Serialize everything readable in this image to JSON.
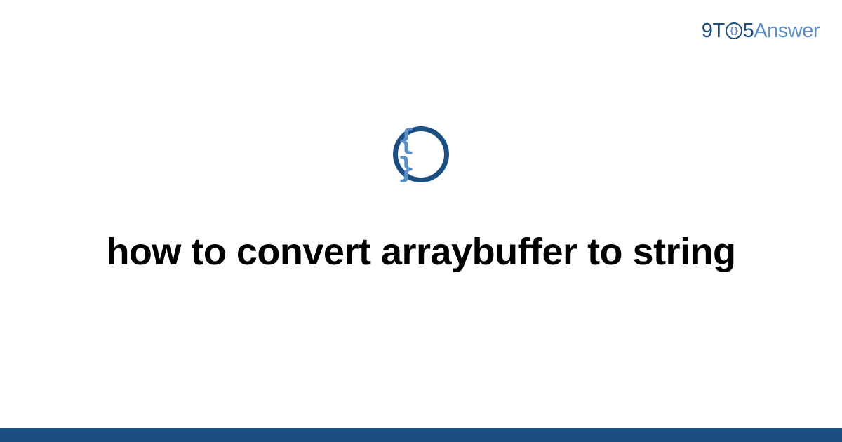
{
  "logo": {
    "nine": "9",
    "t": "T",
    "circle_content": "{}",
    "five": "5",
    "answer": "Answer"
  },
  "icon": {
    "content": "{ }"
  },
  "title": "how to convert arraybuffer to string",
  "colors": {
    "dark_blue": "#1a4d80",
    "light_blue": "#5b8fc7"
  }
}
